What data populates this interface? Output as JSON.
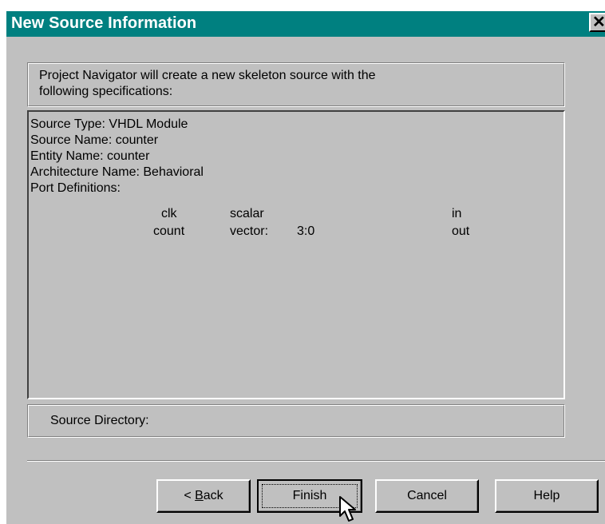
{
  "window": {
    "title": "New Source Information",
    "close_glyph": "✕"
  },
  "intro": {
    "line1": "Project Navigator will create a new skeleton source with the",
    "line2": "following specifications:"
  },
  "details": {
    "source_type": "Source Type:  VHDL Module",
    "source_name": "Source Name:  counter",
    "entity_name": "Entity Name:  counter",
    "architecture_name": "Architecture Name:  Behavioral",
    "port_definitions_label": "Port Definitions:",
    "ports": [
      {
        "name": "clk",
        "type": "scalar",
        "range": "",
        "direction": "in"
      },
      {
        "name": "count",
        "type": "vector:",
        "range": "3:0",
        "direction": "out"
      }
    ]
  },
  "source_directory": {
    "label": "Source Directory:"
  },
  "buttons": {
    "back_prefix": "< ",
    "back_accel": "B",
    "back_rest": "ack",
    "finish": "Finish",
    "cancel": "Cancel",
    "help": "Help"
  },
  "colors": {
    "titlebar": "#008080",
    "face": "#c0c0c0"
  }
}
